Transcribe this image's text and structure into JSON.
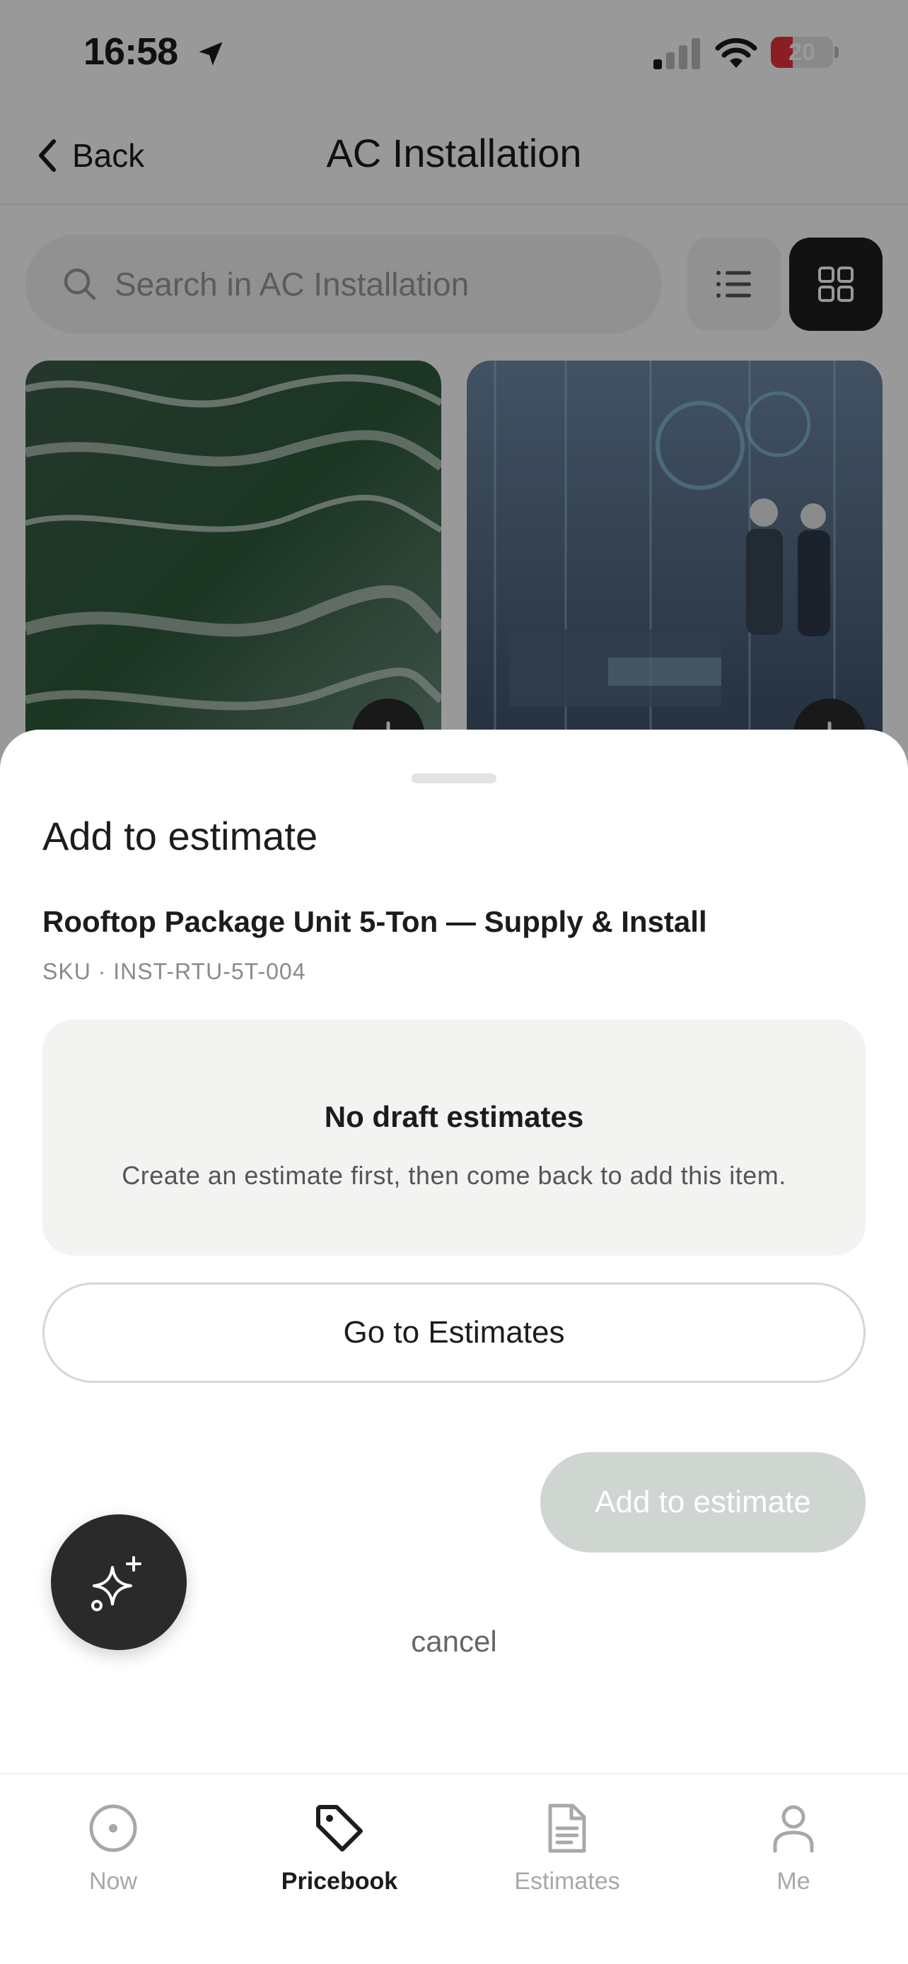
{
  "status_bar": {
    "time": "16:58",
    "battery": "20",
    "battery_level": 0.2,
    "battery_color": "#e8323a"
  },
  "nav": {
    "back_label": "Back",
    "title": "AC Installation"
  },
  "search": {
    "placeholder": "Search in AC Installation"
  },
  "view_toggle": {
    "selected": "grid"
  },
  "sheet": {
    "title": "Add to estimate",
    "item_name": "Rooftop Package Unit 5-Ton — Supply & Install",
    "sku": "SKU · INST-RTU-5T-004",
    "empty_title": "No draft estimates",
    "empty_description": "Create an estimate first, then come back to add this item.",
    "go_button": "Go to Estimates",
    "add_button": "Add to estimate",
    "cancel": "cancel"
  },
  "tabs": [
    {
      "label": "Now",
      "icon": "circle-dot-icon",
      "active": false
    },
    {
      "label": "Pricebook",
      "icon": "tag-icon",
      "active": true
    },
    {
      "label": "Estimates",
      "icon": "document-icon",
      "active": false
    },
    {
      "label": "Me",
      "icon": "person-icon",
      "active": false
    }
  ],
  "colors": {
    "accent_dark": "#1f1f1f",
    "disabled_button": "#cfd6d1",
    "overlay": "rgba(0,0,0,0.40)"
  }
}
